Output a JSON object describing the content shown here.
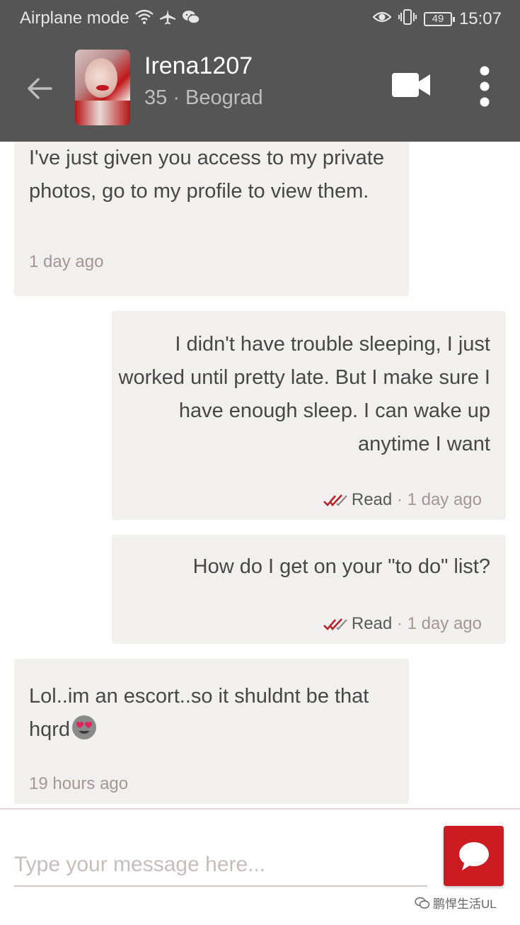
{
  "status_bar": {
    "airplane_mode_label": "Airplane mode",
    "icons": [
      "wifi-icon",
      "airplane-icon",
      "wechat-icon",
      "eye-icon",
      "vibrate-icon"
    ],
    "battery_level": "49",
    "time": "15:07"
  },
  "header": {
    "user_name": "Irena1207",
    "user_meta": "35 · Beograd",
    "icons": [
      "back-arrow-icon",
      "video-camera-icon",
      "more-vertical-icon"
    ]
  },
  "messages": [
    {
      "direction": "incoming",
      "text": "I've just given you access to my private photos, go to my profile to view them.",
      "time": "1 day ago"
    },
    {
      "direction": "outgoing",
      "text": "I didn't have trouble sleeping, I just worked until pretty late. But I make sure I have enough sleep. I can wake up anytime I want",
      "status": "Read",
      "separator": " · ",
      "time": "1 day ago"
    },
    {
      "direction": "outgoing",
      "text": "How do I get on your \"to do\" list?",
      "status": "Read",
      "separator": " · ",
      "time": "1 day ago"
    },
    {
      "direction": "incoming",
      "text": "Lol..im an escort..so it shuldnt be that hqrd",
      "emoji": "heart-eyes-emoji",
      "time": "19 hours ago"
    }
  ],
  "composer": {
    "placeholder": "Type your message here...",
    "value": "",
    "send_icon": "chat-bubble-icon"
  },
  "watermark": {
    "text": "鹏悍生活UL",
    "icon": "wechat-icon"
  },
  "colors": {
    "app_bar": "#555555",
    "bubble": "#f2f0ef",
    "accent": "#cc1b21",
    "read_check": "#b5242a",
    "meta_text": "#a39693"
  }
}
